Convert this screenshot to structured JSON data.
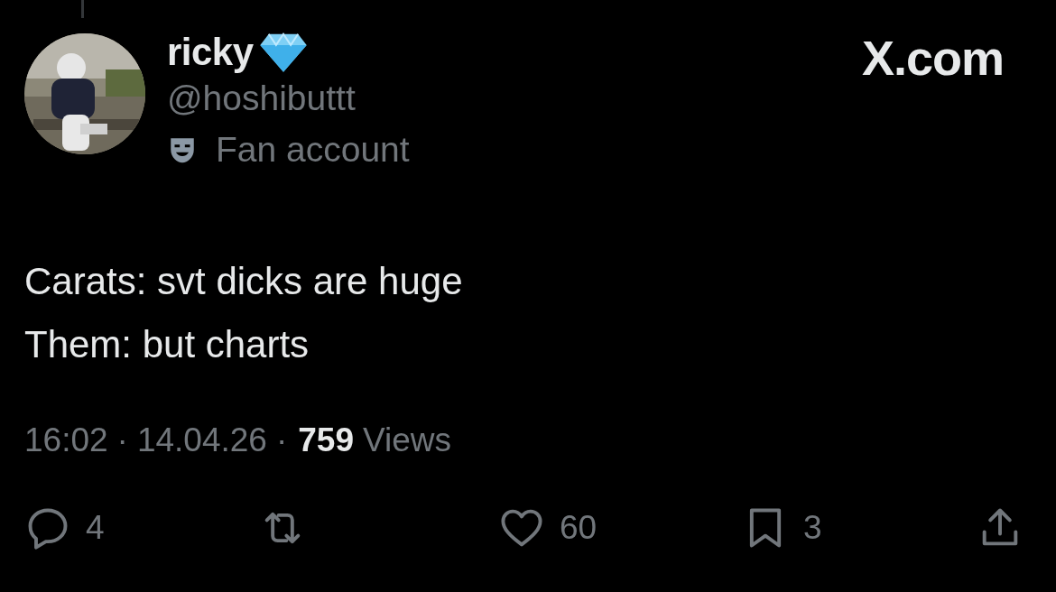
{
  "header": {
    "display_name": "ricky",
    "handle": "@hoshibuttt",
    "label": "Fan account",
    "brand": "X.com"
  },
  "tweet": {
    "lines": [
      "Carats: svt dicks are huge",
      "Them: but charts"
    ]
  },
  "meta": {
    "time": "16:02",
    "separator_1": "·",
    "date": "14.04.26",
    "separator_2": "·",
    "views_count": "759",
    "views_label": "Views"
  },
  "actions": [
    {
      "kind": "reply",
      "count": "4"
    },
    {
      "kind": "retweet"
    },
    {
      "kind": "like",
      "count": "60"
    },
    {
      "kind": "bookmark",
      "count": "3"
    },
    {
      "kind": "share"
    }
  ]
}
